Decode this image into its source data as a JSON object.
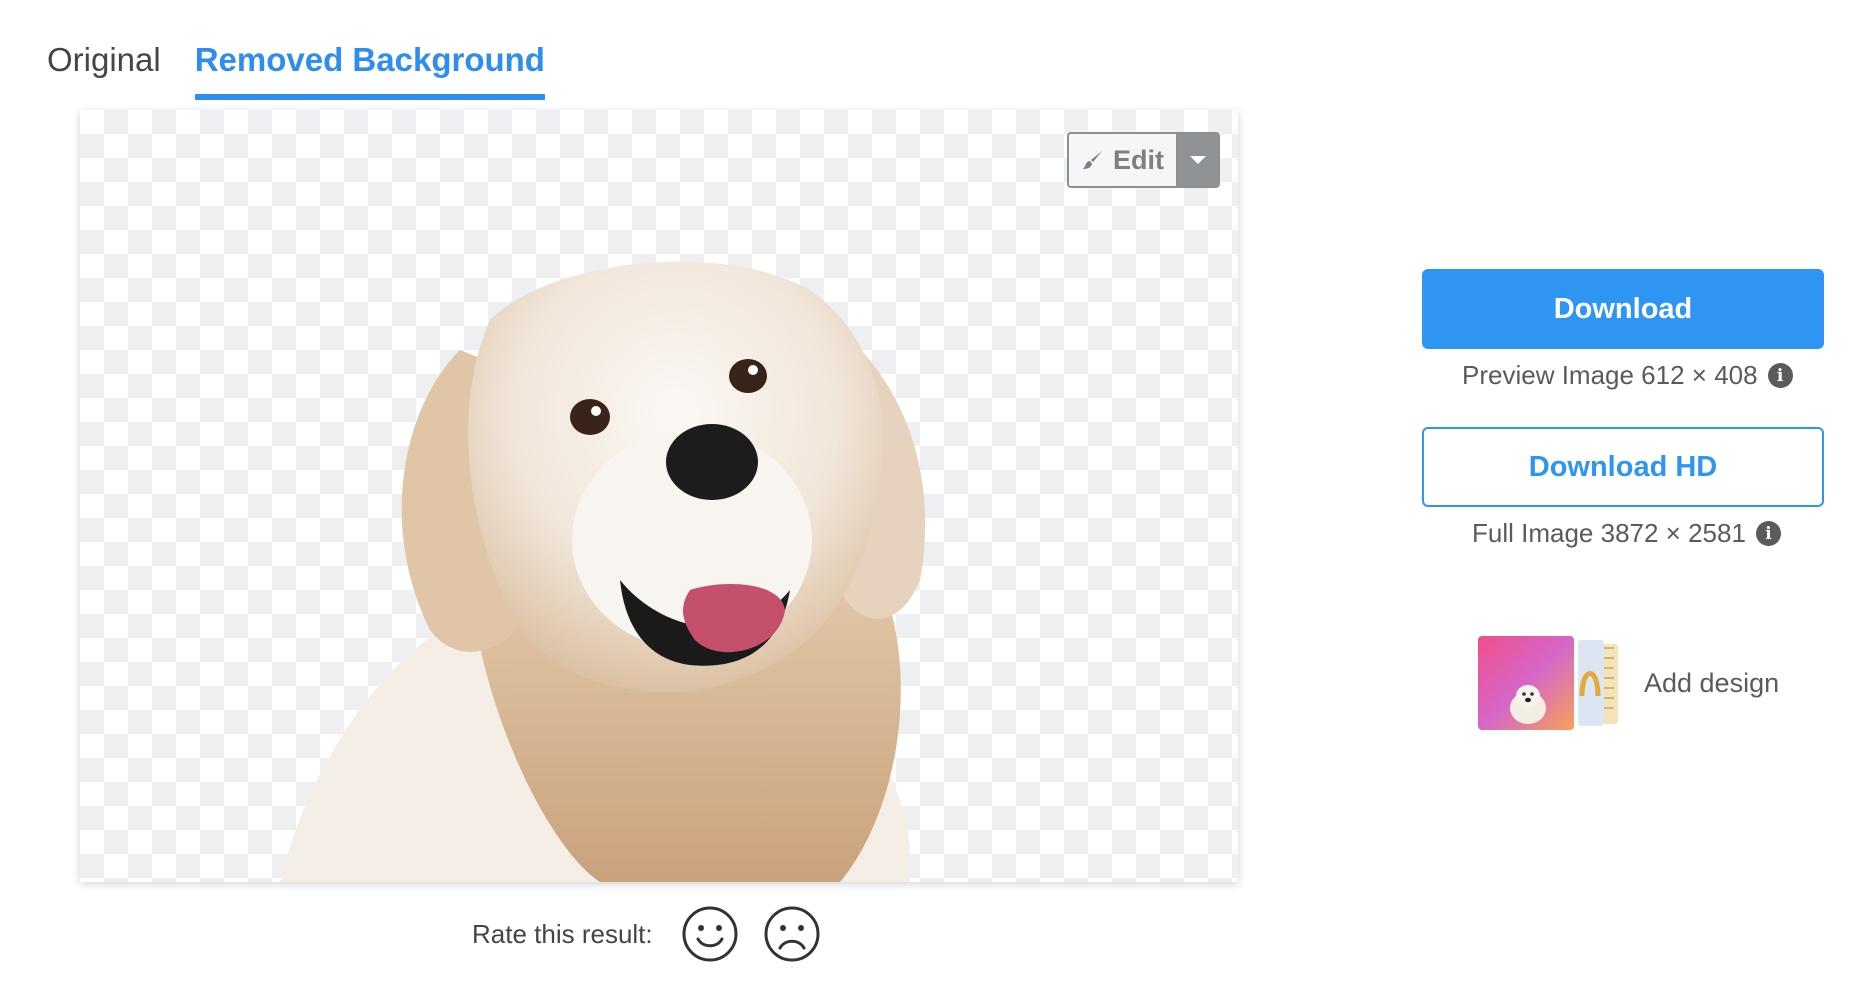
{
  "tabs": [
    {
      "label": "Original",
      "active": false
    },
    {
      "label": "Removed Background",
      "active": true
    }
  ],
  "preview": {
    "edit_label": "Edit"
  },
  "rating": {
    "label": "Rate this result:"
  },
  "download": {
    "label": "Download",
    "info_text": "Preview Image 612 × 408"
  },
  "download_hd": {
    "label": "Download HD",
    "info_text": "Full Image 3872 × 2581"
  },
  "add_design": {
    "label": "Add design"
  },
  "colors": {
    "accent": "#2f95f3",
    "text": "#454545",
    "checker": "#edeff1"
  },
  "icons": [
    "brush-icon",
    "caret-down-icon",
    "smile-icon",
    "frown-icon",
    "info-icon"
  ]
}
